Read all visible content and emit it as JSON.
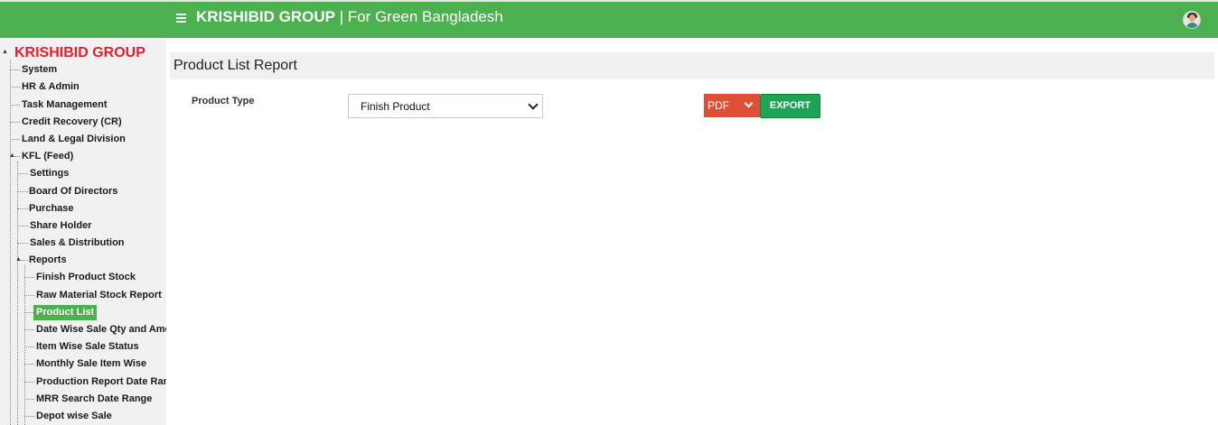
{
  "header": {
    "brand": "KRISHIBID GROUP",
    "separator": " | ",
    "tagline": "For Green Bangladesh"
  },
  "sidebar": {
    "root": "KRISHIBID GROUP",
    "items": [
      {
        "label": "System"
      },
      {
        "label": "HR & Admin"
      },
      {
        "label": "Task Management"
      },
      {
        "label": "Credit Recovery (CR)"
      },
      {
        "label": "Land & Legal Division"
      },
      {
        "label": "KFL (Feed)"
      },
      {
        "label": "Settings"
      },
      {
        "label": "Board Of Directors"
      },
      {
        "label": "Purchase"
      },
      {
        "label": "Share Holder"
      },
      {
        "label": "Sales & Distribution"
      },
      {
        "label": "Reports"
      },
      {
        "label": "Finish Product Stock"
      },
      {
        "label": "Raw Material Stock Report"
      },
      {
        "label": "Product List"
      },
      {
        "label": "Date Wise Sale Qty and Amount"
      },
      {
        "label": "Item Wise Sale Status"
      },
      {
        "label": "Monthly Sale Item Wise"
      },
      {
        "label": "Production Report Date Range"
      },
      {
        "label": "MRR Search Date Range"
      },
      {
        "label": "Depot wise Sale"
      }
    ]
  },
  "main": {
    "title": "Product List Report",
    "product_type_label": "Product Type",
    "product_type_value": "Finish Product",
    "format_value": "PDF",
    "export_label": "EXPORT"
  },
  "colors": {
    "header_bg": "#4caf50",
    "brand_red": "#e5202c",
    "active_item": "#4caf50",
    "format_bg": "#e04e35",
    "export_bg": "#1fa356"
  }
}
